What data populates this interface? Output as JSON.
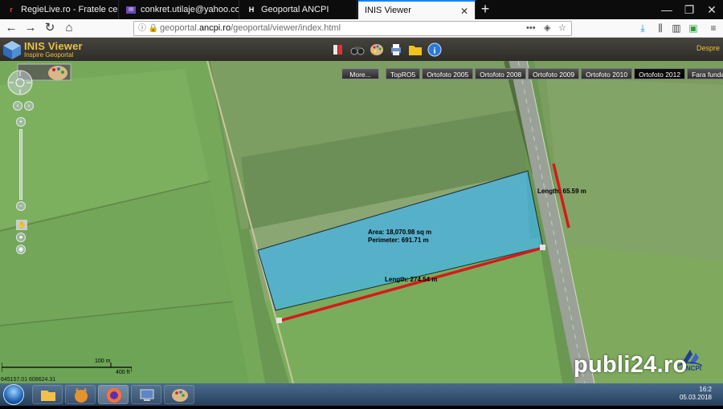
{
  "browser": {
    "tabs": [
      {
        "title": "RegieLive.ro - Fratele cel mare",
        "favicon": "r-icon"
      },
      {
        "title": "conkret.utilaje@yahoo.com - Yah",
        "favicon": "mail-icon"
      },
      {
        "title": "Geoportal ANCPI",
        "favicon": "h-icon"
      },
      {
        "title": "INIS Viewer",
        "favicon": "blank-icon",
        "active": true
      }
    ],
    "new_tab": "+",
    "window_controls": {
      "minimize": "—",
      "restore": "❐",
      "close": "✕"
    },
    "url_prefix": "geoportal.",
    "url_host": "ancpi.ro",
    "url_path": "/geoportal/viewer/index.html"
  },
  "app": {
    "title": "INIS Viewer",
    "subtitle": "Inspire Geoportal",
    "about_link": "Despre",
    "accent_color": "#e9c241"
  },
  "map": {
    "more_button": "More...",
    "layers": [
      {
        "label": "TopRO5",
        "selected": false
      },
      {
        "label": "Ortofoto 2005",
        "selected": false
      },
      {
        "label": "Ortofoto 2008",
        "selected": false
      },
      {
        "label": "Ortofoto 2009",
        "selected": false
      },
      {
        "label": "Ortofoto 2010",
        "selected": false
      },
      {
        "label": "Ortofoto 2012",
        "selected": true
      },
      {
        "label": "Fara fundal",
        "selected": false
      }
    ],
    "measurements": {
      "area": "Area: 18,070.98 sq m",
      "perimeter": "Perimeter: 691.71 m",
      "length_east": "Length: 65.59 m",
      "length_south": "Length: 274.54 m"
    },
    "scale": {
      "metric": "100 m",
      "imperial": "400 ft"
    },
    "coordinates": "645157.01 608624.31",
    "logo_text": "ANCPI"
  },
  "watermark": "publi24.ro",
  "taskbar": {
    "time": "16:2",
    "date": "05.03.2018"
  }
}
